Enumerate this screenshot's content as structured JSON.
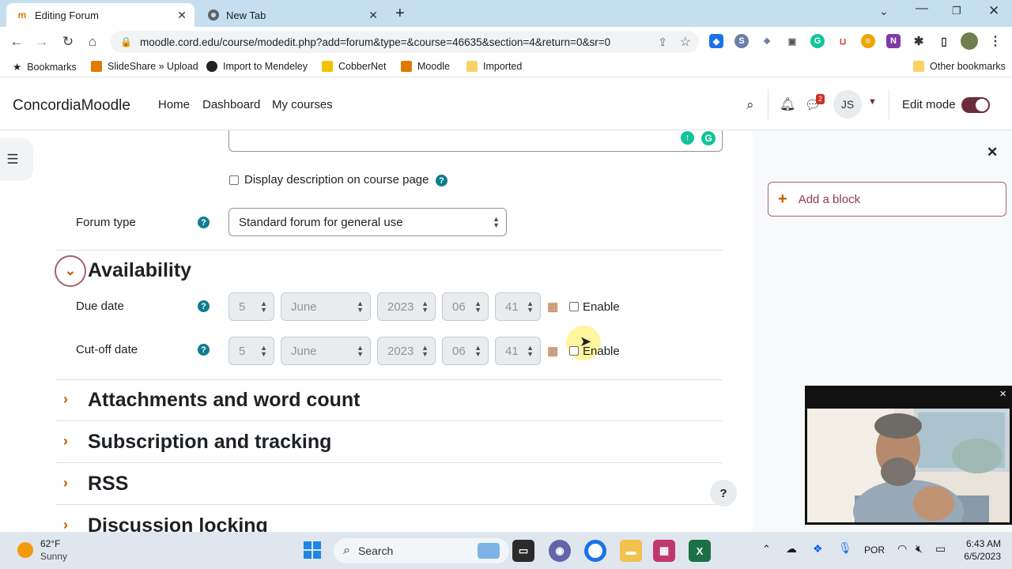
{
  "browser": {
    "tabs": [
      {
        "label": "Editing Forum",
        "active": true
      },
      {
        "label": "New Tab",
        "active": false
      }
    ],
    "url": "moodle.cord.edu/course/modedit.php?add=forum&type=&course=46635&section=4&return=0&sr=0",
    "bookmarks": [
      "Bookmarks",
      "SlideShare » Upload",
      "Import to Mendeley",
      "CobberNet",
      "Moodle",
      "Imported"
    ],
    "other_bookmarks": "Other bookmarks"
  },
  "moodle": {
    "brand": "ConcordiaMoodle",
    "nav": [
      "Home",
      "Dashboard",
      "My courses"
    ],
    "messages_count": "2",
    "user_initials": "JS",
    "edit_mode_label": "Edit mode"
  },
  "form": {
    "display_description": "Display description on course page",
    "forum_type_label": "Forum type",
    "forum_type_value": "Standard forum for general use",
    "availability_heading": "Availability",
    "due_date": {
      "label": "Due date",
      "day": "5",
      "month": "June",
      "year": "2023",
      "hour": "06",
      "minute": "41",
      "enable_label": "Enable"
    },
    "cutoff_date": {
      "label": "Cut-off date",
      "day": "5",
      "month": "June",
      "year": "2023",
      "hour": "06",
      "minute": "41",
      "enable_label": "Enable"
    },
    "sections": [
      "Attachments and word count",
      "Subscription and tracking",
      "RSS",
      "Discussion locking"
    ]
  },
  "drawer": {
    "add_block": "Add a block"
  },
  "help_button": "?",
  "taskbar": {
    "temperature": "62°F",
    "condition": "Sunny",
    "search_placeholder": "Search",
    "language": "POR",
    "time": "6:43 AM",
    "date": "6/5/2023"
  },
  "colors": {
    "tabbar": "#c5dff0",
    "moodle_accent": "#6b2d3c",
    "help_icon": "#0f7c8f",
    "section_chevron": "#c06000"
  }
}
